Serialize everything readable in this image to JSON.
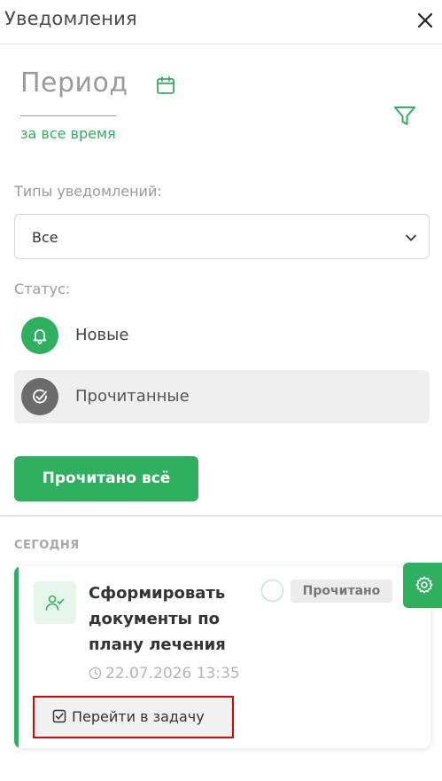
{
  "header": {
    "title": "Уведомления"
  },
  "period": {
    "label": "Период",
    "value": "за все время"
  },
  "types": {
    "label": "Типы уведомлений:",
    "selected": "Все"
  },
  "status": {
    "label": "Статус:",
    "options": [
      {
        "label": "Новые",
        "active": false
      },
      {
        "label": "Прочитанные",
        "active": true
      }
    ]
  },
  "actions": {
    "mark_all_read": "Прочитано всё"
  },
  "feed": {
    "section_title": "СЕГОДНЯ",
    "items": [
      {
        "title": "Сформировать документы по плану лечения",
        "badge": "Прочитано",
        "datetime": "22.07.2026 13:35",
        "action": "Перейти в задачу"
      }
    ]
  },
  "colors": {
    "accent": "#2eb05f",
    "muted": "#9a9a9a",
    "highlight": "#e00000"
  }
}
